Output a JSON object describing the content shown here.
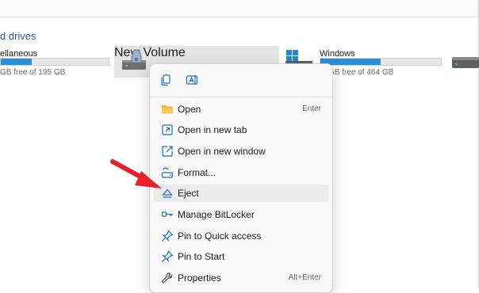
{
  "section": {
    "title": "d drives"
  },
  "drives": [
    {
      "name": "ellaneous",
      "free_text": "GB free of 195 GB",
      "used_fraction": 0.29
    },
    {
      "name": "New Volume"
    },
    {
      "name": "Windows",
      "free_text": "GB free of 464 GB",
      "used_fraction": 0.5
    }
  ],
  "context_menu": {
    "quick_actions": [
      {
        "icon": "copy-icon"
      },
      {
        "icon": "rename-icon"
      }
    ],
    "items": [
      {
        "label": "Open",
        "shortcut": "Enter",
        "icon": "folder-icon"
      },
      {
        "label": "Open in new tab",
        "shortcut": "",
        "icon": "open-new-tab-icon"
      },
      {
        "label": "Open in new window",
        "shortcut": "",
        "icon": "open-new-window-icon"
      },
      {
        "label": "Format...",
        "shortcut": "",
        "icon": "format-icon"
      },
      {
        "label": "Eject",
        "shortcut": "",
        "icon": "eject-icon",
        "highlighted": true
      },
      {
        "label": "Manage BitLocker",
        "shortcut": "",
        "icon": "bitlocker-key-icon"
      },
      {
        "label": "Pin to Quick access",
        "shortcut": "",
        "icon": "pin-icon"
      },
      {
        "label": "Pin to Start",
        "shortcut": "",
        "icon": "pin-icon"
      },
      {
        "label": "Properties",
        "shortcut": "Alt+Enter",
        "icon": "wrench-icon"
      }
    ]
  },
  "colors": {
    "accent": "#2a8fd8",
    "arrow": "#e8202a",
    "link": "#2c5aa0"
  }
}
